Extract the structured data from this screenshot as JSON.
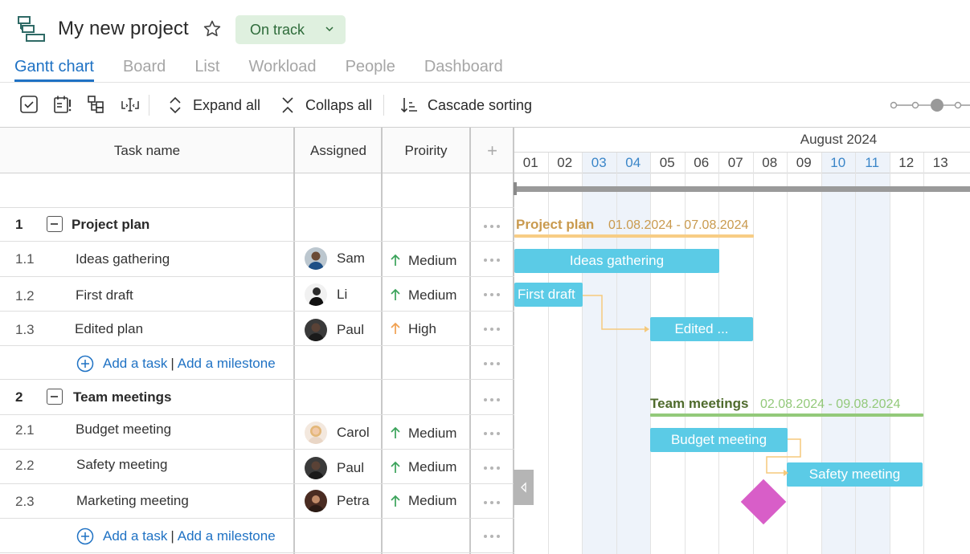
{
  "header": {
    "project_title": "My new project",
    "status_label": "On track",
    "status_color": "#dff0df"
  },
  "tabs": [
    {
      "label": "Gantt chart",
      "active": true
    },
    {
      "label": "Board",
      "active": false
    },
    {
      "label": "List",
      "active": false
    },
    {
      "label": "Workload",
      "active": false
    },
    {
      "label": "People",
      "active": false
    },
    {
      "label": "Dashboard",
      "active": false
    }
  ],
  "toolbar": {
    "icons": [
      "select-all-icon",
      "calendar-exclamation-icon",
      "hierarchy-icon",
      "text-width-icon"
    ],
    "expand_all": "Expand all",
    "collapse_all": "Collaps all",
    "cascade_sorting": "Cascade sorting"
  },
  "columns": {
    "task_name": "Task name",
    "assigned": "Assigned",
    "priority": "Proirity",
    "add_column": "+"
  },
  "groups": [
    {
      "number": "1",
      "name": "Project plan",
      "dates": "01.08.2024 - 07.08.2024",
      "color": "#c99a4e",
      "line_color": "#f7cd85",
      "tasks": [
        {
          "number": "1.1",
          "name": "Ideas gathering",
          "assignee": "Sam",
          "priority": "Medium",
          "start": 1,
          "end": 6
        },
        {
          "number": "1.2",
          "name": "First draft",
          "assignee": "Li",
          "priority": "Medium",
          "start": 1,
          "end": 2
        },
        {
          "number": "1.3",
          "name": "Edited plan",
          "assignee": "Paul",
          "priority": "High",
          "start": 5,
          "end": 7,
          "bar_label": "Edited ..."
        }
      ]
    },
    {
      "number": "2",
      "name": "Team meetings",
      "dates": "02.08.2024 - 09.08.2024",
      "color": "#4f6b2c",
      "line_color": "#93c97a",
      "tasks": [
        {
          "number": "2.1",
          "name": "Budget meeting",
          "assignee": "Carol",
          "priority": "Medium",
          "start": 5,
          "end": 8
        },
        {
          "number": "2.2",
          "name": "Safety meeting",
          "assignee": "Paul",
          "priority": "Medium",
          "start": 9,
          "end": 12
        },
        {
          "number": "2.3",
          "name": "Marketing meeting",
          "assignee": "Petra",
          "priority": "Medium",
          "milestone": true
        }
      ]
    }
  ],
  "add_row": {
    "add_task": "Add a task",
    "separator": "|",
    "add_milestone": "Add a milestone"
  },
  "timeline": {
    "month": "August 2024",
    "days": [
      "01",
      "02",
      "03",
      "04",
      "05",
      "06",
      "07",
      "08",
      "09",
      "10",
      "11",
      "12",
      "13"
    ],
    "weekend_days": [
      "03",
      "04",
      "10",
      "11"
    ]
  },
  "priority_colors": {
    "Medium": "#3aa35a",
    "High": "#f0a050"
  },
  "bar_color": "#5bcbe6",
  "milestone_color": "#d85ec8"
}
